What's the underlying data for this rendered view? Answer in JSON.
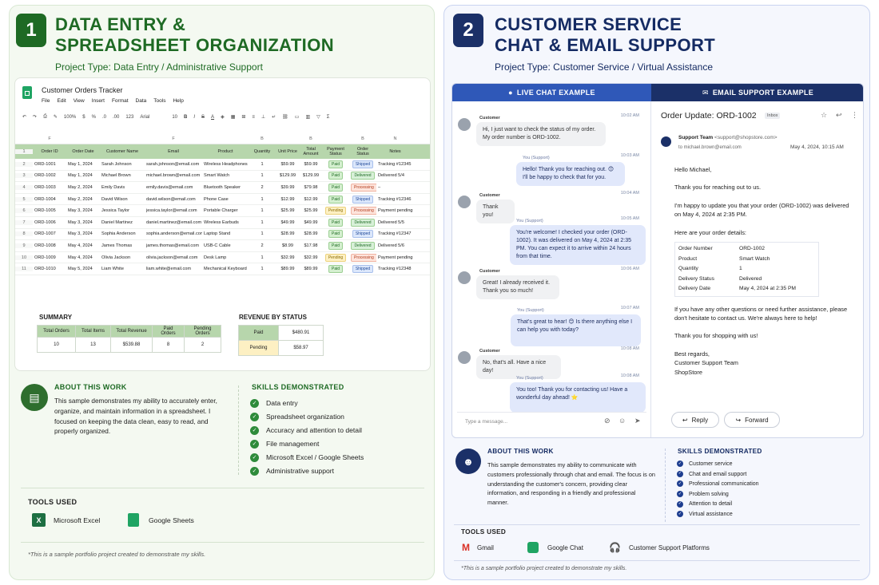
{
  "colors": {
    "green": "#1e6a24",
    "navy": "#152b63",
    "chat_tab": "#2f58b8",
    "email_tab": "#1b3068"
  },
  "left": {
    "number": "1",
    "title": "DATA ENTRY &\nSPREADSHEET ORGANIZATION",
    "project_type": "Project Type: Data Entry / Administrative Support",
    "sheet": {
      "name": "Customer Orders Tracker",
      "menu": [
        "File",
        "Edit",
        "View",
        "Insert",
        "Format",
        "Data",
        "Tools",
        "Help"
      ],
      "toolbar": {
        "zoom": "100%",
        "currency": "$",
        "percent": "%",
        "dec1": ".0",
        "dec2": ".00",
        "num": "123",
        "font": "Arial",
        "size": "10"
      },
      "col_letters": [
        "",
        "",
        "F",
        "",
        "",
        "F",
        "",
        "B",
        "",
        "B",
        "",
        "B",
        "N"
      ],
      "headers": [
        "Order ID",
        "Order Date",
        "Customer Name",
        "Email",
        "Product",
        "Quantity",
        "Unit Price",
        "Total Amount",
        "Payment Status",
        "Order Status",
        "Notes"
      ],
      "rows": [
        [
          "ORD-1001",
          "May 1, 2024",
          "Sarah Johnson",
          "sarah.johnson@email.com",
          "Wireless Headphones",
          "1",
          "$59.99",
          "$59.99",
          "Paid",
          "Shipped",
          "Tracking #12345"
        ],
        [
          "ORD-1002",
          "May 1, 2024",
          "Michael Brown",
          "michael.brown@email.com",
          "Smart Watch",
          "1",
          "$129.99",
          "$129.99",
          "Paid",
          "Delivered",
          "Delivered 5/4"
        ],
        [
          "ORD-1003",
          "May 2, 2024",
          "Emily Davis",
          "emily.davis@email.com",
          "Bluetooth Speaker",
          "2",
          "$39.99",
          "$79.98",
          "Paid",
          "Processing",
          "–"
        ],
        [
          "ORD-1004",
          "May 2, 2024",
          "David Wilson",
          "david.wilson@email.com",
          "Phone Case",
          "1",
          "$12.99",
          "$12.99",
          "Paid",
          "Shipped",
          "Tracking #12346"
        ],
        [
          "ORD-1005",
          "May 3, 2024",
          "Jessica Taylor",
          "jessica.taylor@email.com",
          "Portable Charger",
          "1",
          "$25.99",
          "$25.99",
          "Pending",
          "Processing",
          "Payment pending"
        ],
        [
          "ORD-1006",
          "May 3, 2024",
          "Daniel Martinez",
          "daniel.martinez@email.com",
          "Wireless Earbuds",
          "1",
          "$49.99",
          "$49.99",
          "Paid",
          "Delivered",
          "Delivered 5/5"
        ],
        [
          "ORD-1007",
          "May 3, 2024",
          "Sophia Anderson",
          "sophia.anderson@email.com",
          "Laptop Stand",
          "1",
          "$28.99",
          "$28.99",
          "Paid",
          "Shipped",
          "Tracking #12347"
        ],
        [
          "ORD-1008",
          "May 4, 2024",
          "James Thomas",
          "james.thomas@email.com",
          "USB-C Cable",
          "2",
          "$8.99",
          "$17.98",
          "Paid",
          "Delivered",
          "Delivered 5/6"
        ],
        [
          "ORD-1009",
          "May 4, 2024",
          "Olivia Jackson",
          "olivia.jackson@email.com",
          "Desk Lamp",
          "1",
          "$32.99",
          "$32.99",
          "Pending",
          "Processing",
          "Payment pending"
        ],
        [
          "ORD-1010",
          "May 5, 2024",
          "Liam White",
          "liam.white@email.com",
          "Mechanical Keyboard",
          "1",
          "$89.99",
          "$89.99",
          "Paid",
          "Shipped",
          "Tracking #12348"
        ]
      ],
      "summary_title": "SUMMARY",
      "summary_headers": [
        "Total Orders",
        "Total Items",
        "Total Revenue",
        "Paid Orders",
        "Pending Orders"
      ],
      "summary_values": [
        "10",
        "13",
        "$539.88",
        "8",
        "2"
      ],
      "revenue_title": "REVENUE BY STATUS",
      "revenue": [
        {
          "label": "Paid",
          "value": "$480.91"
        },
        {
          "label": "Pending",
          "value": "$58.97"
        }
      ]
    },
    "about_title": "ABOUT THIS WORK",
    "about_text": "This sample demonstrates my ability to accurately enter, organize, and maintain information in a spreadsheet. I focused on keeping the data clean, easy to read, and properly organized.",
    "skills_title": "SKILLS DEMONSTRATED",
    "skills": [
      "Data entry",
      "Spreadsheet organization",
      "Accuracy and attention to detail",
      "File management",
      "Microsoft Excel / Google Sheets",
      "Administrative support"
    ],
    "tools_title": "TOOLS USED",
    "tools": [
      "Microsoft Excel",
      "Google Sheets"
    ],
    "footnote": "*This is a sample portfolio project created to demonstrate my skills."
  },
  "right": {
    "number": "2",
    "title": "CUSTOMER SERVICE\nCHAT & EMAIL SUPPORT",
    "project_type": "Project Type: Customer Service / Virtual Assistance",
    "chat_tab": "LIVE CHAT EXAMPLE",
    "email_tab": "EMAIL SUPPORT EXAMPLE",
    "chat": [
      {
        "from": "Customer",
        "time": "10:02 AM",
        "text": "Hi, I just want to check the status of my order. My order number is ORD-1002."
      },
      {
        "from": "You (Support)",
        "time": "10:03 AM",
        "text": "Hello! Thank you for reaching out. 😊 I'll be happy to check that for you."
      },
      {
        "from": "Customer",
        "time": "10:04 AM",
        "text": "Thank you!"
      },
      {
        "from": "You (Support)",
        "time": "10:05 AM",
        "text": "You're welcome! I checked your order (ORD-1002). It was delivered on May 4, 2024 at 2:35 PM. You can expect it to arrive within 24 hours from that time."
      },
      {
        "from": "Customer",
        "time": "10:06 AM",
        "text": "Great! I already received it. Thank you so much!"
      },
      {
        "from": "You (Support)",
        "time": "10:07 AM",
        "text": "That's great to hear! 😊 Is there anything else I can help you with today?"
      },
      {
        "from": "Customer",
        "time": "10:08 AM",
        "text": "No, that's all. Have a nice day!"
      },
      {
        "from": "You (Support)",
        "time": "10:08 AM",
        "text": "You too! Thank you for contacting us! Have a wonderful day ahead! ⭐"
      }
    ],
    "chat_placeholder": "Type a message...",
    "email": {
      "subject": "Order Update: ORD-1002",
      "label": "Inbox",
      "sender": "Support Team",
      "sender_addr": "<support@shopstore.com>",
      "to": "to michael.brown@email.com",
      "date": "May 4, 2024, 10:15 AM",
      "greeting": "Hello Michael,",
      "p1": "Thank you for reaching out to us.",
      "p2": "I'm happy to update you that your order (ORD-1002) was delivered on May 4, 2024 at 2:35 PM.",
      "p3": "Here are your order details:",
      "details": [
        {
          "k": "Order Number",
          "v": "ORD-1002"
        },
        {
          "k": "Product",
          "v": "Smart Watch"
        },
        {
          "k": "Quantity",
          "v": "1"
        },
        {
          "k": "Delivery Status",
          "v": "Delivered"
        },
        {
          "k": "Delivery Date",
          "v": "May 4, 2024 at 2:35 PM"
        }
      ],
      "p4": "If you have any other questions or need further assistance, please don't hesitate to contact us. We're always here to help!",
      "p5": "Thank you for shopping with us!",
      "sign1": "Best regards,",
      "sign2": "Customer Support Team",
      "sign3": "ShopStore",
      "reply": "Reply",
      "forward": "Forward"
    },
    "about_title": "ABOUT THIS WORK",
    "about_text": "This sample demonstrates my ability to communicate with customers professionally through chat and email. The focus is on understanding the customer's concern, providing clear information, and responding in a friendly and professional manner.",
    "skills_title": "SKILLS DEMONSTRATED",
    "skills": [
      "Customer service",
      "Chat and email support",
      "Professional communication",
      "Problem solving",
      "Attention to detail",
      "Virtual assistance"
    ],
    "tools_title": "TOOLS USED",
    "tools": [
      "Gmail",
      "Google Chat",
      "Customer Support Platforms"
    ],
    "footnote": "*This is a sample portfolio project created to demonstrate my skills."
  }
}
